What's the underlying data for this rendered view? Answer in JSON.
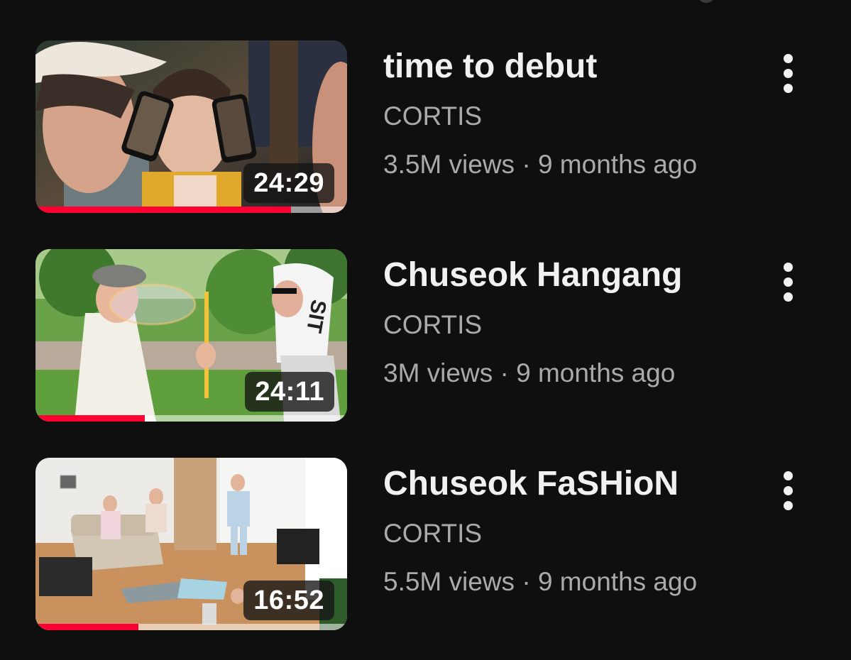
{
  "videos": [
    {
      "title": "time to debut",
      "channel": "CORTIS",
      "views": "3.5M views",
      "age": "9 months ago",
      "duration": "24:29",
      "watched_fraction": 0.82,
      "menu_icon": "more-vert-icon"
    },
    {
      "title": "Chuseok Hangang",
      "channel": "CORTIS",
      "views": "3M views",
      "age": "9 months ago",
      "duration": "24:11",
      "watched_fraction": 0.35,
      "menu_icon": "more-vert-icon"
    },
    {
      "title": "Chuseok FaSHioN",
      "channel": "CORTIS",
      "views": "5.5M views",
      "age": "9 months ago",
      "duration": "16:52",
      "watched_fraction": 0.33,
      "menu_icon": "more-vert-icon"
    }
  ],
  "separator": "·",
  "colors": {
    "background": "#0f0f0f",
    "progress": "#ff0033",
    "title": "#f1f1f1",
    "secondary": "#aaaaaa"
  }
}
